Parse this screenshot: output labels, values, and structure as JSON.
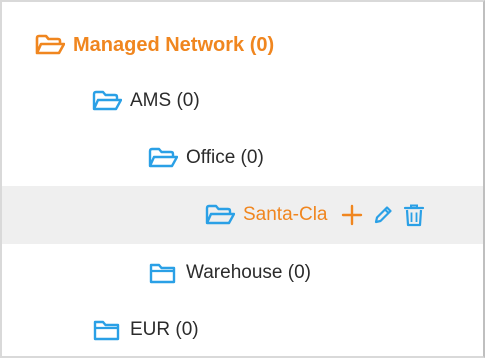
{
  "tree": {
    "root": {
      "label": "Managed Network (0)",
      "icon": "folder-open-icon",
      "color": "#f0861f"
    },
    "ams": {
      "label": "AMS (0)",
      "icon": "folder-open-icon"
    },
    "office": {
      "label": "Office (0)",
      "icon": "folder-open-icon"
    },
    "santa": {
      "label": "Santa-Cla",
      "icon": "folder-open-icon",
      "selected": true,
      "actions": [
        "add-icon",
        "edit-icon",
        "delete-icon"
      ]
    },
    "warehouse": {
      "label": "Warehouse (0)",
      "icon": "folder-icon"
    },
    "eur": {
      "label": "EUR (0)",
      "icon": "folder-icon"
    }
  },
  "colors": {
    "accent": "#f0861f",
    "folder_blue": "#2aa0e6",
    "selected_bg": "#efefef"
  }
}
